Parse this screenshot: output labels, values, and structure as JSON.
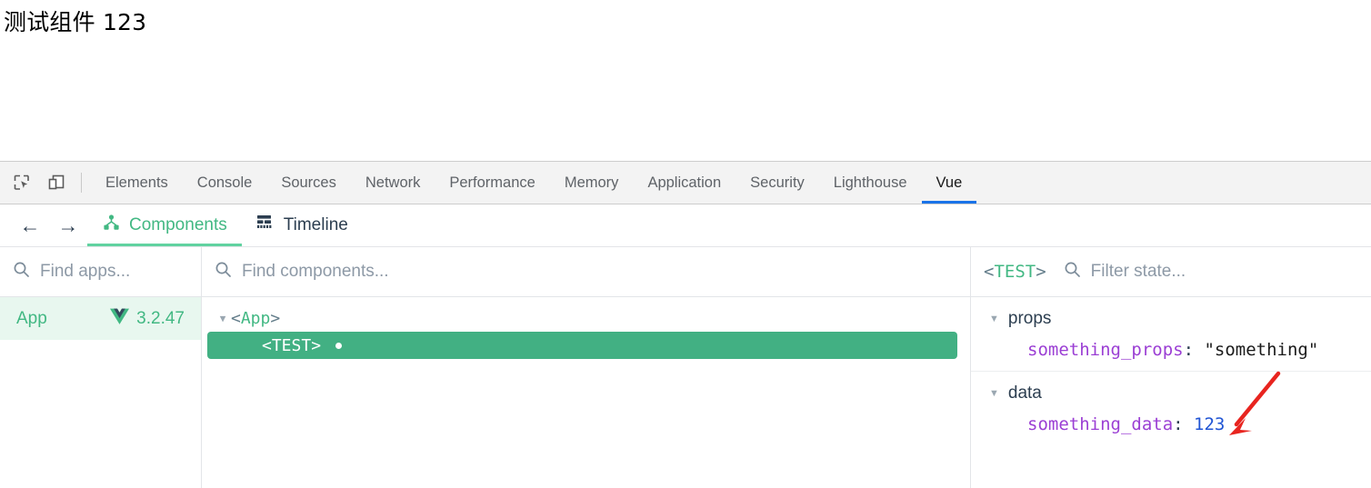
{
  "page": {
    "heading": "测试组件 123"
  },
  "devtools": {
    "icons": [
      {
        "name": "inspect-element-icon",
        "label": "Inspect element"
      },
      {
        "name": "device-toolbar-icon",
        "label": "Toggle device toolbar"
      }
    ],
    "tabs": [
      {
        "label": "Elements",
        "active": false
      },
      {
        "label": "Console",
        "active": false
      },
      {
        "label": "Sources",
        "active": false
      },
      {
        "label": "Network",
        "active": false
      },
      {
        "label": "Performance",
        "active": false
      },
      {
        "label": "Memory",
        "active": false
      },
      {
        "label": "Application",
        "active": false
      },
      {
        "label": "Security",
        "active": false
      },
      {
        "label": "Lighthouse",
        "active": false
      },
      {
        "label": "Vue",
        "active": true
      }
    ],
    "active_tab_underline_color": "#1a73e8"
  },
  "vue_panel": {
    "nav": {
      "back": "←",
      "forward": "→"
    },
    "tabs": [
      {
        "label": "Components",
        "icon": "component-tree-icon",
        "active": true
      },
      {
        "label": "Timeline",
        "icon": "timeline-icon",
        "active": false
      }
    ],
    "accent_color": "#42b883",
    "apps": {
      "search_placeholder": "Find apps...",
      "items": [
        {
          "name": "App",
          "version": "3.2.47",
          "selected": true,
          "icon": "vue-logo-icon"
        }
      ]
    },
    "components": {
      "search_placeholder": "Find components...",
      "tree": [
        {
          "open_bracket": "<",
          "name": "App",
          "close_bracket": ">",
          "caret": "▼",
          "depth": 0,
          "selected": false,
          "has_dot": false
        },
        {
          "open_bracket": "<",
          "name": "TEST",
          "close_bracket": ">",
          "caret": "",
          "depth": 1,
          "selected": true,
          "has_dot": true
        }
      ]
    },
    "state": {
      "target": {
        "open_bracket": "<",
        "name": "TEST",
        "close_bracket": ">"
      },
      "filter_placeholder": "Filter state...",
      "groups": [
        {
          "title": "props",
          "caret": "▼",
          "entries": [
            {
              "key": "something_props",
              "value": "\"something\"",
              "value_type": "string"
            }
          ]
        },
        {
          "title": "data",
          "caret": "▼",
          "entries": [
            {
              "key": "something_data",
              "value": "123",
              "value_type": "number"
            }
          ]
        }
      ]
    }
  },
  "annotation": {
    "arrow_color": "#e8241f",
    "points_at": "something_data: 123"
  }
}
